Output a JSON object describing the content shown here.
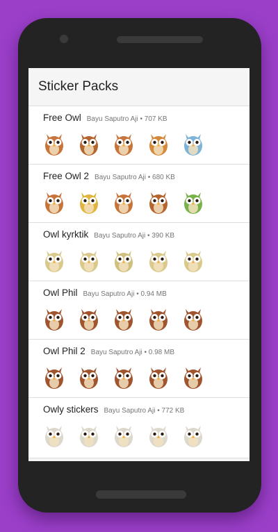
{
  "screen": {
    "title": "Sticker Packs"
  },
  "packs": [
    {
      "name": "Free Owl",
      "author": "Bayu Saputro Aji",
      "size": "707 KB",
      "colors": [
        "#c8753c",
        "#b5652f",
        "#c8753c",
        "#d48a3a",
        "#7fb3d8"
      ],
      "stickers": [
        "owl-reading-sticker",
        "owl-surprised-sticker",
        "owl-hug-sticker",
        "owl-laptop-sticker",
        "owl-hola-sticker"
      ]
    },
    {
      "name": "Free Owl 2",
      "author": "Bayu Saputro Aji",
      "size": "680 KB",
      "colors": [
        "#c8753c",
        "#e0b640",
        "#c8753c",
        "#b5652f",
        "#7ab24b"
      ],
      "stickers": [
        "owl-dance-sticker",
        "owl-cheer-sticker",
        "owl-think-sticker",
        "owl-hide-sticker",
        "owl-work-sticker"
      ]
    },
    {
      "name": "Owl kyrktik",
      "author": "Bayu Saputro Aji",
      "size": "390 KB",
      "colors": [
        "#d9c98a",
        "#d9c98a",
        "#cfc07e",
        "#d9c98a",
        "#d9c98a"
      ],
      "stickers": [
        "owl-face-sticker",
        "owl-stand-sticker",
        "owl-dog-sticker",
        "owl-walk-sticker",
        "owl-grin-sticker"
      ]
    },
    {
      "name": "Owl Phil",
      "author": "Bayu Saputro Aji",
      "size": "0.94 MB",
      "colors": [
        "#a0552f",
        "#a0552f",
        "#a0552f",
        "#a0552f",
        "#a0552f"
      ],
      "stickers": [
        "owl-phil-sit-sticker",
        "owl-phil-wink-sticker",
        "owl-phil-love-sticker",
        "owl-phil-read-sticker",
        "owl-phil-happy-sticker"
      ]
    },
    {
      "name": "Owl Phil 2",
      "author": "Bayu Saputro Aji",
      "size": "0.98 MB",
      "colors": [
        "#a0552f",
        "#a0552f",
        "#a0552f",
        "#a0552f",
        "#a0552f"
      ],
      "stickers": [
        "owl-phil-question-sticker",
        "owl-phil-hat-sticker",
        "owl-phil-newspaper-sticker",
        "owl-phil-sleep-sticker",
        "owl-phil-teatime-sticker"
      ]
    },
    {
      "name": "Owly stickers",
      "author": "Bayu Saputro Aji",
      "size": "772 KB",
      "colors": [
        "#dcd8cc",
        "#dcd8cc",
        "#dcd8cc",
        "#dcd8cc",
        "#dcd8cc"
      ],
      "stickers": [
        "owly-sad-sticker",
        "owly-back-sticker",
        "owly-love-sticker",
        "owly-fly-sticker",
        "owly-sleepy-sticker"
      ]
    }
  ]
}
